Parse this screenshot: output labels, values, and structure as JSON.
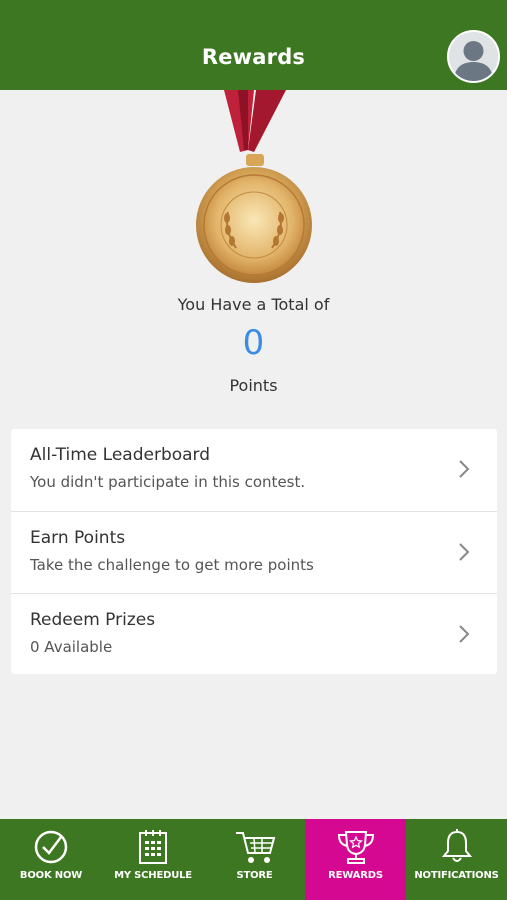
{
  "header": {
    "title": "Rewards"
  },
  "summary": {
    "total_label": "You Have a Total of",
    "points_value": "0",
    "points_label": "Points"
  },
  "menu": [
    {
      "title": "All-Time Leaderboard",
      "subtitle": "You didn't participate in this contest."
    },
    {
      "title": "Earn Points",
      "subtitle": "Take the challenge to get more points"
    },
    {
      "title": "Redeem Prizes",
      "subtitle": "0 Available"
    }
  ],
  "tabs": [
    {
      "label": "BOOK NOW",
      "icon": "check-circle-icon"
    },
    {
      "label": "MY SCHEDULE",
      "icon": "calendar-icon"
    },
    {
      "label": "STORE",
      "icon": "cart-icon"
    },
    {
      "label": "REWARDS",
      "icon": "trophy-icon",
      "active": true
    },
    {
      "label": "NOTIFICATIONS",
      "icon": "bell-icon"
    }
  ],
  "colors": {
    "header_bg": "#3e7722",
    "active_tab": "#d40891",
    "points": "#3a8de3"
  }
}
